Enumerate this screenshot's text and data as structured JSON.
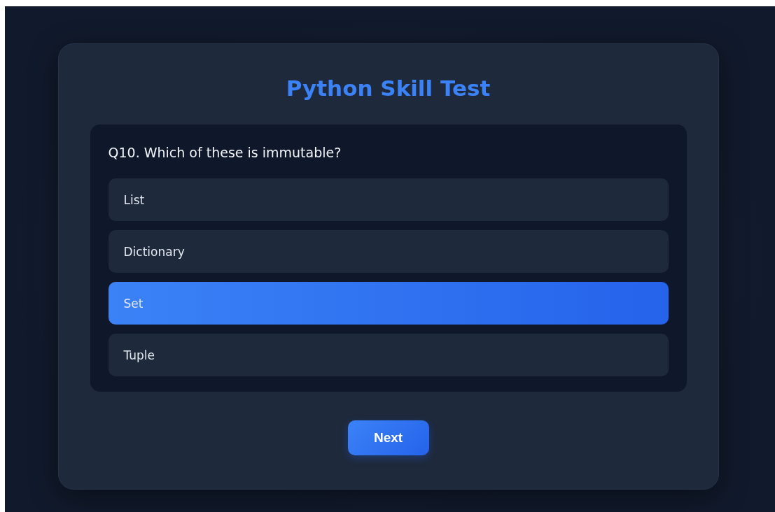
{
  "title": "Python Skill Test",
  "question": "Q10. Which of these is immutable?",
  "options": [
    {
      "label": "List",
      "selected": false
    },
    {
      "label": "Dictionary",
      "selected": false
    },
    {
      "label": "Set",
      "selected": true
    },
    {
      "label": "Tuple",
      "selected": false
    }
  ],
  "next_button": "Next"
}
